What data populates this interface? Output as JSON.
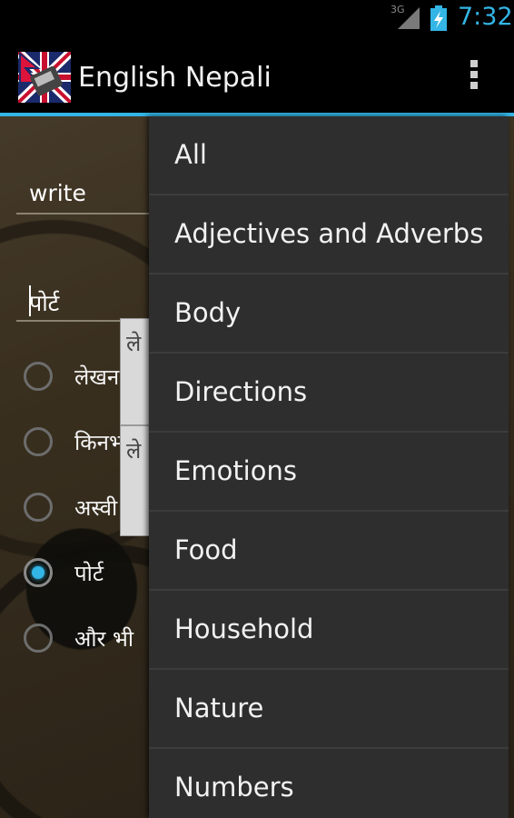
{
  "status_bar": {
    "network": "3G",
    "time": "7:32",
    "accent_color": "#33b5e5"
  },
  "app_bar": {
    "title": "English Nepali",
    "icon": "flag-translator-icon",
    "menu_icon": "overflow-menu-icon"
  },
  "inputs": {
    "english": "write",
    "nepali": "पोर्ट"
  },
  "options": [
    {
      "label": "लेखन",
      "selected": false
    },
    {
      "label": "किनभ",
      "selected": false
    },
    {
      "label": "अस्वी",
      "selected": false
    },
    {
      "label": "पोर्ट",
      "selected": true
    },
    {
      "label": "और भी",
      "selected": false
    }
  ],
  "popup_peek": [
    "ले",
    "ले"
  ],
  "dropdown": {
    "items": [
      "All",
      "Adjectives and Adverbs",
      "Body",
      "Directions",
      "Emotions",
      "Food",
      "Household",
      "Nature",
      "Numbers"
    ]
  }
}
